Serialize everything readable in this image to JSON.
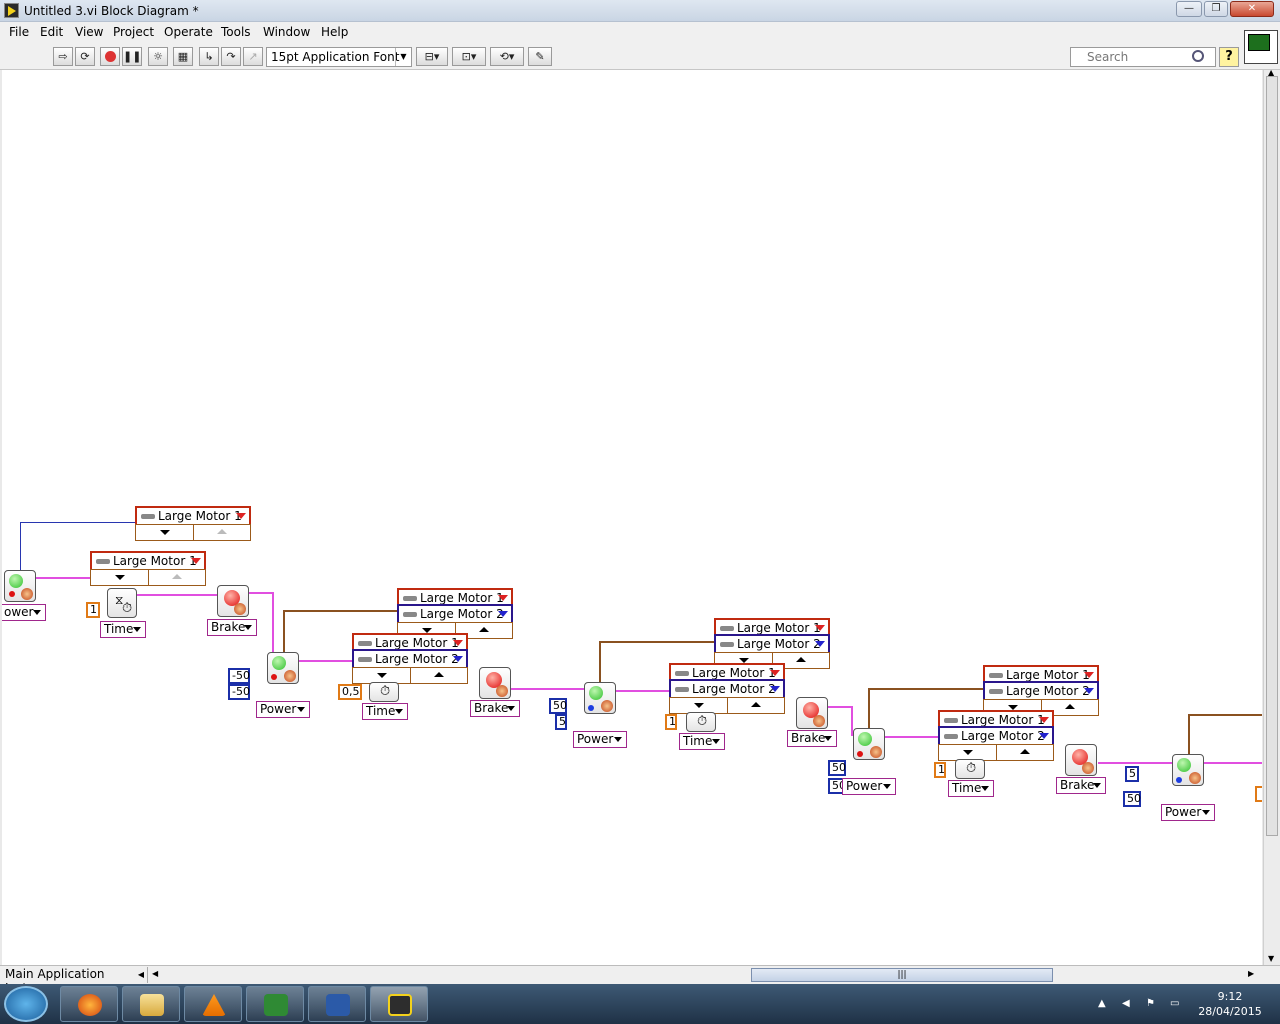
{
  "window": {
    "title": "Untitled 3.vi Block Diagram *",
    "minimize": "—",
    "maximize": "❐",
    "close": "✕"
  },
  "menu": [
    "File",
    "Edit",
    "View",
    "Project",
    "Operate",
    "Tools",
    "Window",
    "Help"
  ],
  "toolbar": {
    "font": "15pt Application Font",
    "search_placeholder": "Search",
    "help": "?"
  },
  "status": {
    "instance": "Main Application Instance",
    "hscroll_grip": "|||"
  },
  "taskbar": {
    "time": "9:12",
    "date": "28/04/2015"
  },
  "colors": {
    "wire_power": "#e14fe0",
    "wire_ports": "#8a5120",
    "numeric": "#1b2fa8",
    "numeric_int": "#e07a16",
    "port_a": "#c02a10",
    "port_b": "#2a168c"
  },
  "diagram": {
    "port_m1": "Large Motor 1",
    "port_m2": "Large Motor 2",
    "mode_power": "Power",
    "mode_power_cut": "ower",
    "mode_time": "Time",
    "mode_brake": "Brake",
    "values": {
      "neg50": "-50",
      "half": "0,5",
      "one": "1",
      "fifty": "50",
      "five": "5"
    }
  }
}
